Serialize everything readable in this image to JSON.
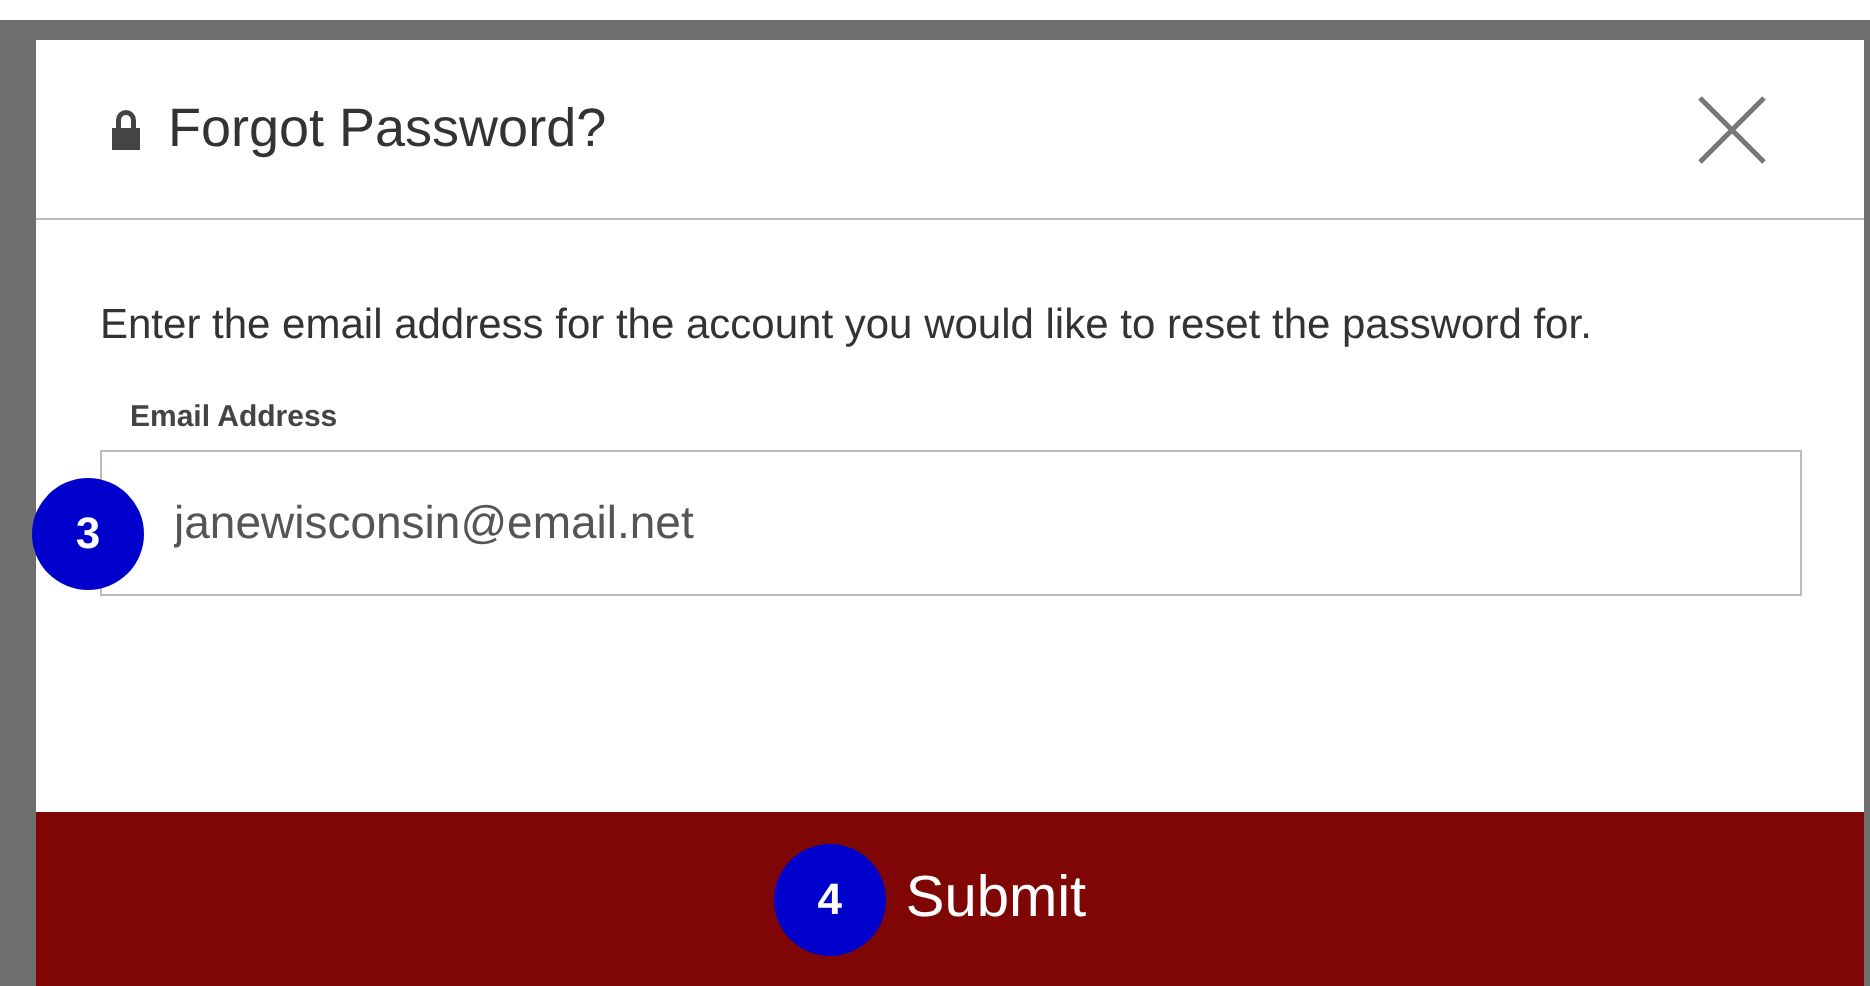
{
  "dialog": {
    "title": "Forgot Password?",
    "message": "Enter the email address for the account you would like to reset the password for.",
    "email_field": {
      "label": "Email Address",
      "value": "janewisconsin@email.net"
    },
    "submit_button": "Submit"
  },
  "callouts": [
    "3",
    "4"
  ]
}
